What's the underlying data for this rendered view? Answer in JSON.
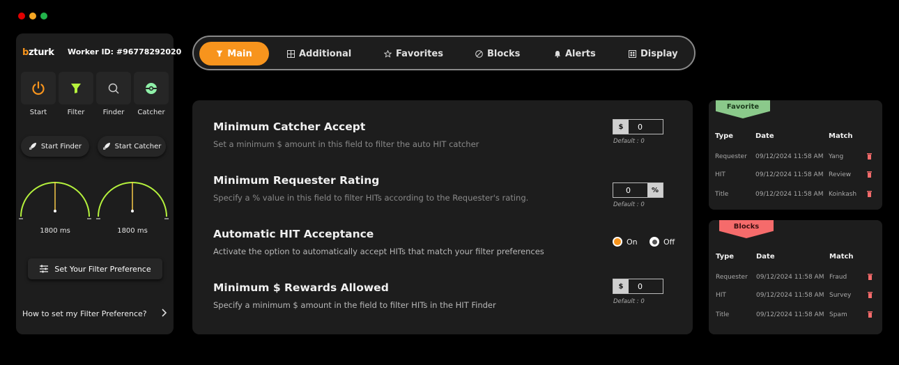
{
  "window": {
    "dots": [
      "#e00000",
      "#f5a623",
      "#22b34b"
    ]
  },
  "sidebar": {
    "logo": {
      "b": "b",
      "rest": "zturk"
    },
    "worker_id": "Worker ID: #96778292020",
    "tiles": [
      {
        "label": "Start",
        "icon": "power-icon",
        "color": "#f7941d"
      },
      {
        "label": "Filter",
        "icon": "filter-icon",
        "color": "#b5f23d"
      },
      {
        "label": "Finder",
        "icon": "search-icon",
        "color": "#cccccc"
      },
      {
        "label": "Catcher",
        "icon": "catcher-icon",
        "color": "#8ff0a8"
      }
    ],
    "start_finder": "Start Finder",
    "start_catcher": "Start Catcher",
    "gauges": [
      {
        "label": "1800 ms",
        "level": 0.5,
        "color": "#b5f23d"
      },
      {
        "label": "1800 ms",
        "level": 0.5,
        "color": "#b5f23d"
      }
    ],
    "filter_pref_button": "Set Your Filter Preference",
    "howto_link": "How to set my Filter Preference?"
  },
  "tabs": [
    {
      "label": "Main",
      "icon": "filter-icon"
    },
    {
      "label": "Additional",
      "icon": "grid-icon"
    },
    {
      "label": "Favorites",
      "icon": "star-icon"
    },
    {
      "label": "Blocks",
      "icon": "block-icon"
    },
    {
      "label": "Alerts",
      "icon": "bell-icon"
    },
    {
      "label": "Display",
      "icon": "display-icon"
    }
  ],
  "settings": {
    "catcher": {
      "title": "Minimum Catcher Accept",
      "desc": "Set a minimum $ amount in this field to filter the auto HIT catcher",
      "unit": "$",
      "value": "0",
      "default": "Default : 0"
    },
    "rating": {
      "title": "Minimum Requester Rating",
      "desc": "Specify a % value in this field to filter HITs according to the Requester's rating.",
      "unit": "%",
      "value": "0",
      "default": "Default : 0"
    },
    "auto_accept": {
      "title": "Automatic HIT Acceptance",
      "desc": "Activate the option to automatically accept HITs that match your filter preferences",
      "on": "On",
      "off": "Off",
      "selected": "On"
    },
    "rewards": {
      "title": "Minimum $ Rewards Allowed",
      "desc": "Specify a minimum $ amount in the field to filter HITs in the HIT Finder",
      "unit": "$",
      "value": "0",
      "default": "Default : 0"
    }
  },
  "favorite": {
    "title": "Favorite",
    "color": "#8bc98b",
    "headers": [
      "Type",
      "Date",
      "Match"
    ],
    "rows": [
      [
        "Requester",
        "09/12/2024 11:58 AM",
        "Yang"
      ],
      [
        "HIT",
        "09/12/2024 11:58 AM",
        "Review"
      ],
      [
        "Title",
        "09/12/2024 11:58 AM",
        "Koinkash"
      ]
    ]
  },
  "blocks": {
    "title": "Blocks",
    "color": "#f56b6b",
    "headers": [
      "Type",
      "Date",
      "Match"
    ],
    "rows": [
      [
        "Requester",
        "09/12/2024 11:58 AM",
        "Fraud"
      ],
      [
        "HIT",
        "09/12/2024 11:58 AM",
        "Survey"
      ],
      [
        "Title",
        "09/12/2024 11:58 AM",
        "Spam"
      ]
    ]
  }
}
